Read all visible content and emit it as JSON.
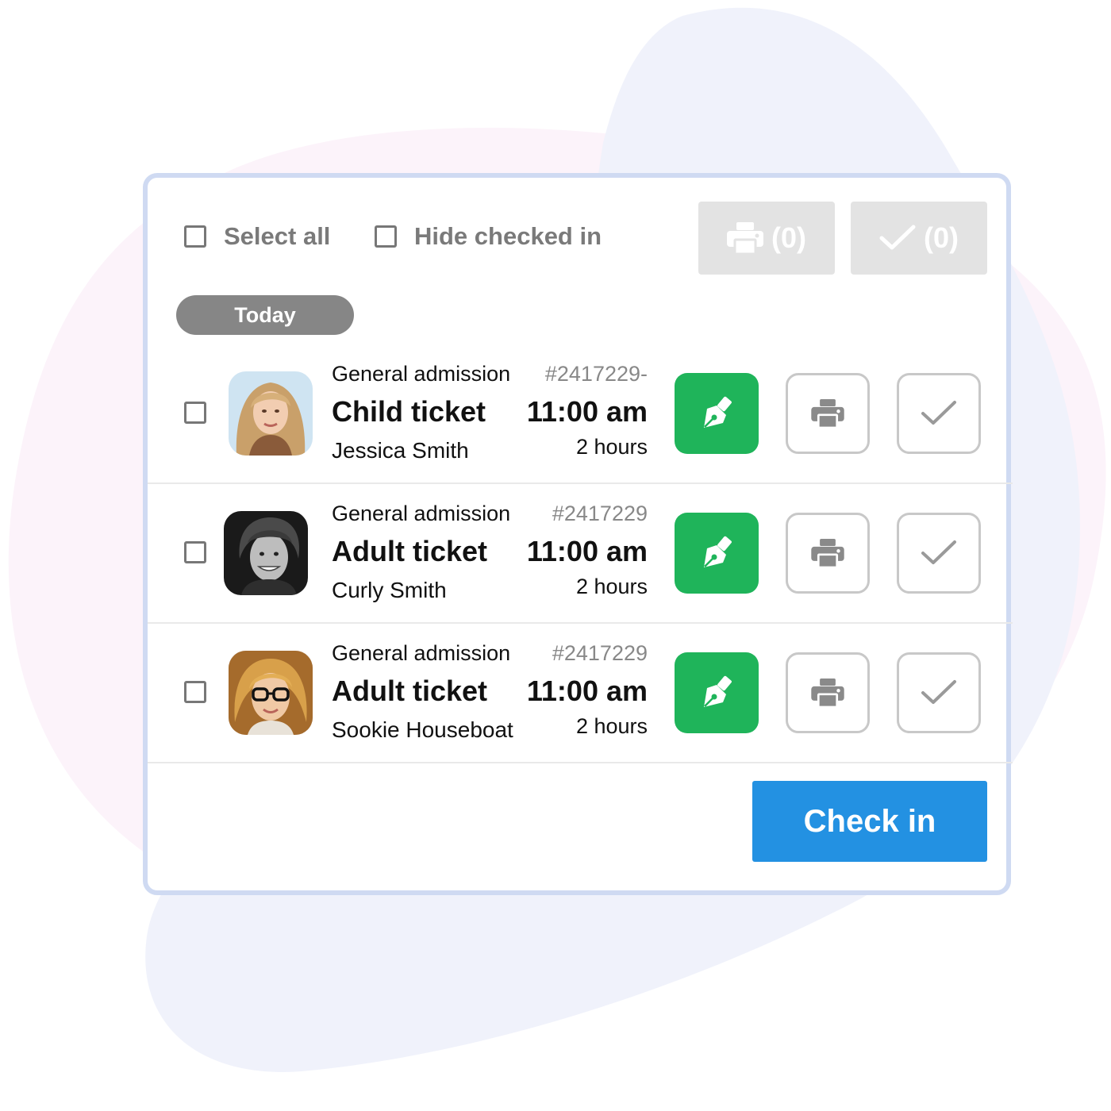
{
  "colors": {
    "panel_border": "#cfdaf2",
    "sign_button": "#1fb45a",
    "check_in_button": "#2391e2",
    "day_pill": "#868686",
    "disabled_button": "#e3e3e3"
  },
  "toolbar": {
    "select_all_label": "Select all",
    "hide_checked_label": "Hide checked in",
    "print_count": "(0)",
    "check_count": "(0)",
    "print_icon": "printer-icon",
    "check_icon": "checkmark-icon"
  },
  "day_label": "Today",
  "tickets": [
    {
      "category": "General admission",
      "number": "#2417229-",
      "title": "Child ticket",
      "time": "11:00 am",
      "name": "Jessica Smith",
      "duration": "2 hours",
      "checked": false
    },
    {
      "category": "General admission",
      "number": "#2417229",
      "title": "Adult ticket",
      "time": "11:00 am",
      "name": "Curly Smith",
      "duration": "2 hours",
      "checked": false
    },
    {
      "category": "General admission",
      "number": "#2417229",
      "title": "Adult ticket",
      "time": "11:00 am",
      "name": "Sookie Houseboat",
      "duration": "2 hours",
      "checked": false
    }
  ],
  "row_actions": {
    "sign_icon": "pen-nib-icon",
    "print_icon": "printer-icon",
    "check_icon": "checkmark-icon"
  },
  "check_in_label": "Check in"
}
